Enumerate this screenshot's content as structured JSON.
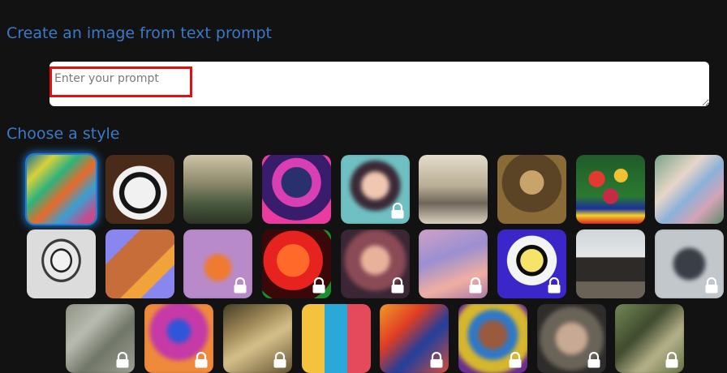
{
  "page": {
    "title": "Create an image from text prompt",
    "style_heading": "Choose a style"
  },
  "prompt": {
    "placeholder": "Enter your prompt",
    "value": ""
  },
  "icons": {
    "lock": "lock-icon"
  },
  "styles": [
    {
      "name": "abstract-paint-style",
      "locked": false,
      "selected": true,
      "blurred": false,
      "bg": "linear-gradient(135deg,#1d6f9b 0%,#d7d23a 20%,#2fb27e 38%,#e86a2b 55%,#3a9fd1 72%,#c64b8a 90%)"
    },
    {
      "name": "panda-style",
      "locked": false,
      "selected": false,
      "blurred": false,
      "bg": "radial-gradient(circle at 50% 55%,#f1f1f1 0 30%,#151515 31% 40%,#f1f1f1 41% 52%,#4a2b1a 53% 100%)"
    },
    {
      "name": "fantasy-landscape-style",
      "locked": false,
      "selected": false,
      "blurred": false,
      "bg": "linear-gradient(180deg,#cfc5a9 0%,#8f8a6d 40%,#4b5a3f 70%,#2c3325 100%)"
    },
    {
      "name": "robot-style",
      "locked": false,
      "selected": false,
      "blurred": false,
      "bg": "radial-gradient(circle at 50% 40%,#2a2f6e 0 28%,#d93fb5 29% 45%,#3a1c6d 46% 70%,#ea3c9f 71% 100%)"
    },
    {
      "name": "anime-portrait-style",
      "locked": true,
      "selected": false,
      "blurred": true,
      "bg": "radial-gradient(circle at 50% 45%,#f0c7b1 0 25%,#3a2a36 26% 45%,#6fc0c2 46% 100%)"
    },
    {
      "name": "engraving-style",
      "locked": false,
      "selected": false,
      "blurred": false,
      "bg": "linear-gradient(180deg,#e5ddcc 0%,#b9ad95 45%,#6f665a 70%,#d9d0be 100%)"
    },
    {
      "name": "renaissance-portrait-style",
      "locked": false,
      "selected": false,
      "blurred": false,
      "bg": "radial-gradient(circle at 50% 40%,#c9a46a 0 22%,#5b4326 23% 55%,#8a6a37 56% 100%)"
    },
    {
      "name": "flower-vase-style",
      "locked": false,
      "selected": false,
      "blurred": false,
      "bg": "radial-gradient(circle at 30% 35%,#e23a2f 0 12%,transparent 13%),radial-gradient(circle at 65% 30%,#f1c231 0 10%,transparent 11%),radial-gradient(circle at 50% 60%,#c52b45 0 14%,transparent 15%),linear-gradient(180deg,#1f5b2a 0%,#2b7a31 60%,#1a2f9b 78%,#f2d229 88%,#d82424 100%)"
    },
    {
      "name": "ballet-painting-style",
      "locked": false,
      "selected": false,
      "blurred": false,
      "bg": "linear-gradient(135deg,#7aa38a 0%,#e7d7c8 35%,#8cb1d8 55%,#d3a4b8 75%,#5f8a6a 100%)"
    },
    {
      "name": "sketch-cup-style",
      "locked": false,
      "selected": false,
      "blurred": false,
      "bg": "radial-gradient(ellipse at 50% 45%,#f2f2f2 0 18%,#222 19% 22%,#e9e9e9 23% 35%,#3a3a3a 36% 40%,#dcdcdc 41% 100%)"
    },
    {
      "name": "isometric-3d-style",
      "locked": false,
      "selected": false,
      "blurred": false,
      "bg": "linear-gradient(135deg,#8a86f0 0%,#8a86f0 25%,#c76d3a 26% 60%,#f1a33b 61% 75%,#8a86f0 76% 100%)"
    },
    {
      "name": "low-poly-fox-style",
      "locked": true,
      "selected": false,
      "blurred": true,
      "bg": "radial-gradient(circle at 50% 55%,#f07a2f 0 24%,#b98ac9 25% 100%)"
    },
    {
      "name": "neon-face-style",
      "locked": true,
      "selected": false,
      "blurred": false,
      "bg": "radial-gradient(circle at 45% 45%,#ff6a2a 0 30%,#e6231f 31% 55%,#3a0808 56% 80%,#1b8f2f 81% 100%)"
    },
    {
      "name": "vintage-portrait-style",
      "locked": true,
      "selected": false,
      "blurred": true,
      "bg": "radial-gradient(circle at 50% 45%,#e8b29a 0 26%,#8a4a56 27% 55%,#3a2635 56% 100%)"
    },
    {
      "name": "pastel-city-style",
      "locked": true,
      "selected": false,
      "blurred": true,
      "bg": "linear-gradient(160deg,#d6a3c6 0%,#9a8fd1 40%,#f1b0a1 70%,#a06fa8 100%)"
    },
    {
      "name": "pop-art-style",
      "locked": true,
      "selected": false,
      "blurred": false,
      "bg": "radial-gradient(circle at 50% 45%,#f6e36a 0 22%,#0c0c0c 23% 30%,#f4f4f4 31% 48%,#3b27c9 49% 100%)"
    },
    {
      "name": "architecture-style",
      "locked": false,
      "selected": false,
      "blurred": false,
      "bg": "linear-gradient(180deg,#cfd5da 0%,#e5e7e8 40%,#2e2a28 41% 75%,#6b6257 76% 100%)"
    },
    {
      "name": "stone-render-style",
      "locked": true,
      "selected": false,
      "blurred": true,
      "bg": "radial-gradient(ellipse at 50% 50%,#3a3f47 0 30%,#c2c7cc 31% 100%)"
    },
    {
      "name": "aerial-map-style",
      "locked": true,
      "selected": false,
      "blurred": true,
      "bg": "linear-gradient(135deg,#8a8f7f 0%,#b9bcb1 35%,#6f7567 60%,#a2a597 100%)"
    },
    {
      "name": "neon-rabbit-style",
      "locked": true,
      "selected": false,
      "blurred": true,
      "bg": "radial-gradient(circle at 50% 40%,#2f55d8 0 20%,#c53aa6 21% 50%,#ef8a3b 51% 100%)"
    },
    {
      "name": "old-painting-style",
      "locked": true,
      "selected": false,
      "blurred": true,
      "bg": "linear-gradient(150deg,#3a3322 0%,#a08a58 35%,#d6c08a 55%,#5b4a2c 100%)"
    },
    {
      "name": "icon-grid-style",
      "locked": false,
      "selected": false,
      "blurred": false,
      "bg": "linear-gradient(90deg,#f4c23c 0 33%,#2aa8d8 33% 66%,#e54a5c 66% 100%)"
    },
    {
      "name": "fire-dragon-style",
      "locked": true,
      "selected": false,
      "blurred": true,
      "bg": "linear-gradient(135deg,#f2a728 0%,#e03c23 35%,#1e3f9e 60%,#e7502e 100%)"
    },
    {
      "name": "mosaic-portrait-style",
      "locked": true,
      "selected": false,
      "blurred": true,
      "bg": "radial-gradient(circle at 50% 45%,#9a5a3c 0 26%,#2f78c8 27% 45%,#d6b62e 46% 70%,#6a2f8e 71% 100%)"
    },
    {
      "name": "fantasy-portrait-style",
      "locked": true,
      "selected": false,
      "blurred": true,
      "bg": "radial-gradient(circle at 50% 50%,#c8a993 0 30%,#6a6358 31% 60%,#2f2d2b 61% 100%)"
    },
    {
      "name": "forest-painting-style",
      "locked": true,
      "selected": false,
      "blurred": true,
      "bg": "linear-gradient(135deg,#7a8f5a 0%,#3f4a2d 40%,#b6b28a 65%,#5b6a3a 100%)"
    }
  ]
}
